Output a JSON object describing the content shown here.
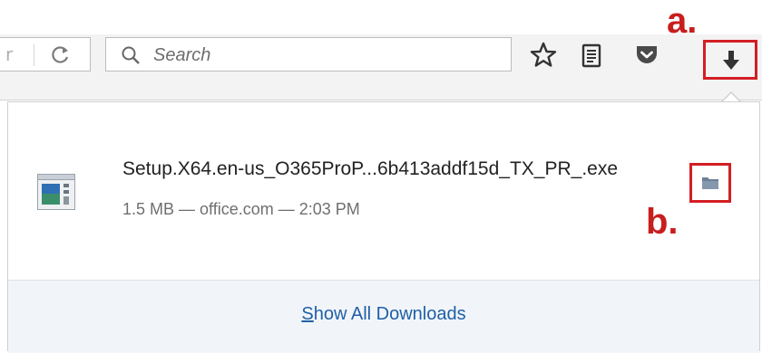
{
  "toolbar": {
    "urlbar_dropdown_glyph": "r",
    "reload_glyph": "C",
    "search": {
      "placeholder": "Search",
      "value": ""
    }
  },
  "annotations": {
    "a": "a.",
    "b": "b."
  },
  "download": {
    "file_name": "Setup.X64.en-us_O365ProP...6b413addf15d_TX_PR_.exe",
    "meta": "1.5 MB — office.com — 2:03 PM"
  },
  "footer": {
    "show_all_first": "S",
    "show_all_rest": "how All Downloads"
  },
  "colors": {
    "annotation_red": "#d31e23",
    "link_blue": "#1f5fa6"
  },
  "icons": [
    "reload-icon",
    "search-icon",
    "bookmark-star-icon",
    "reader-view-icon",
    "pocket-icon",
    "download-arrow-icon",
    "file-icon",
    "folder-icon"
  ]
}
